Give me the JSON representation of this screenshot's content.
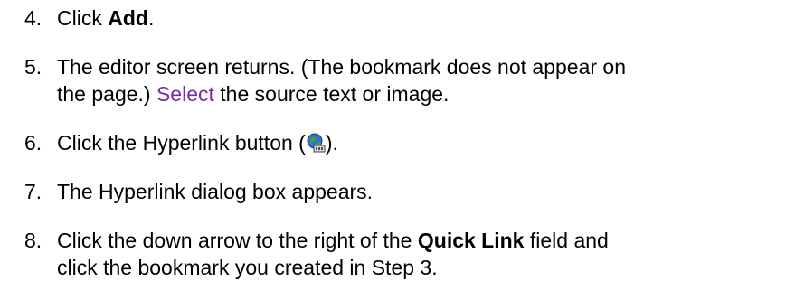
{
  "steps": [
    {
      "number": "4.",
      "pre": "Click ",
      "bold": "Add",
      "post": "."
    },
    {
      "number": "5.",
      "line1": "The editor screen returns. (The bookmark does not appear on",
      "line2_pre": "the page.) ",
      "link": "Select",
      "line2_post": " the source text or image.",
      "link_color": "#7b2aa8"
    },
    {
      "number": "6.",
      "pre": "Click the Hyperlink button (",
      "icon": "hyperlink-globe-icon",
      "post": ")."
    },
    {
      "number": "7.",
      "text": "The Hyperlink dialog box appears."
    },
    {
      "number": "8.",
      "pre": "Click the down arrow to the right of the ",
      "bold": "Quick Link",
      "post_line1": " field and",
      "line2": "click the bookmark you created in Step 3."
    }
  ]
}
